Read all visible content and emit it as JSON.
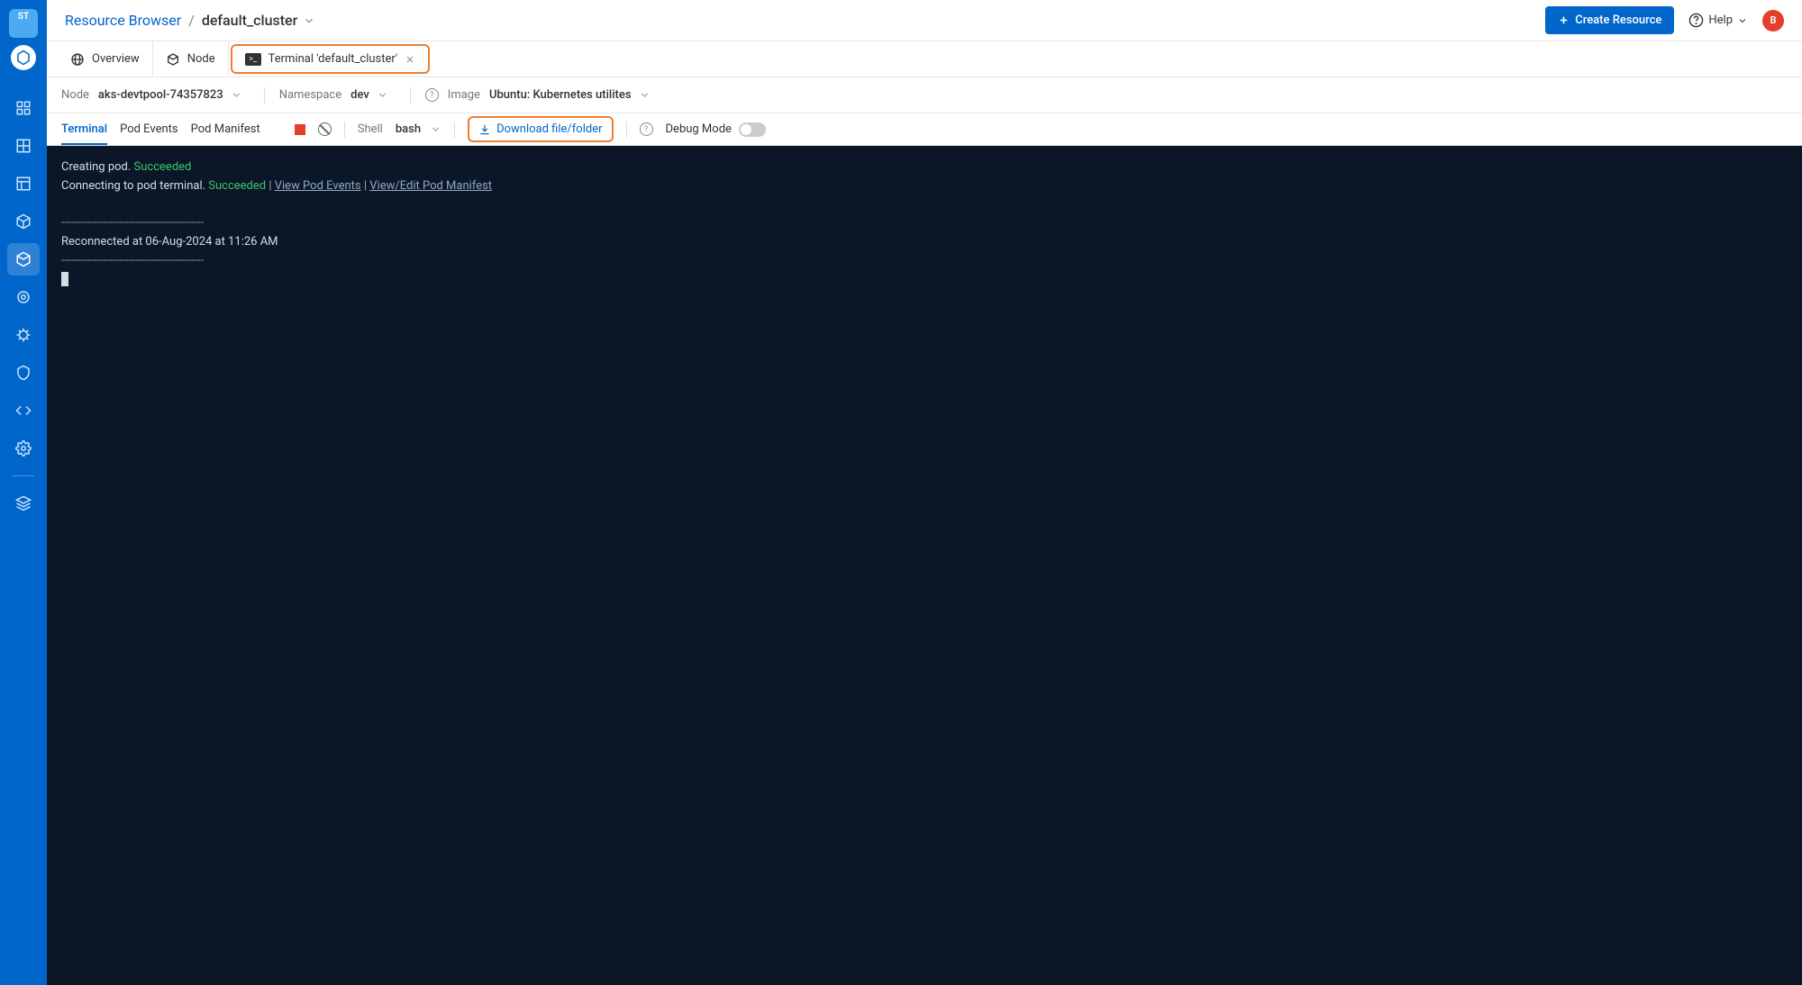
{
  "sidebar": {
    "logo_text": "ST"
  },
  "breadcrumb": {
    "root": "Resource Browser",
    "sep": "/",
    "current": "default_cluster"
  },
  "topbar": {
    "create_label": "Create Resource",
    "help_label": "Help",
    "avatar_letter": "B"
  },
  "tabs": {
    "overview": "Overview",
    "node": "Node",
    "terminal": "Terminal 'default_cluster'"
  },
  "subbar": {
    "node_label": "Node",
    "node_value": "aks-devtpool-74357823",
    "namespace_label": "Namespace",
    "namespace_value": "dev",
    "image_label": "Image",
    "image_value": "Ubuntu: Kubernetes utilites"
  },
  "toolbar": {
    "terminal": "Terminal",
    "pod_events": "Pod Events",
    "pod_manifest": "Pod Manifest",
    "shell_label": "Shell",
    "shell_value": "bash",
    "download": "Download file/folder",
    "debug_label": "Debug Mode"
  },
  "terminal": {
    "line1_a": "Creating pod. ",
    "line1_b": "Succeeded",
    "line2_a": "Connecting to pod terminal. ",
    "line2_b": "Succeeded",
    "line2_sep1": " | ",
    "line2_link1": "View Pod Events",
    "line2_sep2": " | ",
    "line2_link2": "View/Edit Pod Manifest",
    "dashline": "--------------------------------------------",
    "reconnect": "Reconnected at 06-Aug-2024 at 11:26 AM"
  }
}
